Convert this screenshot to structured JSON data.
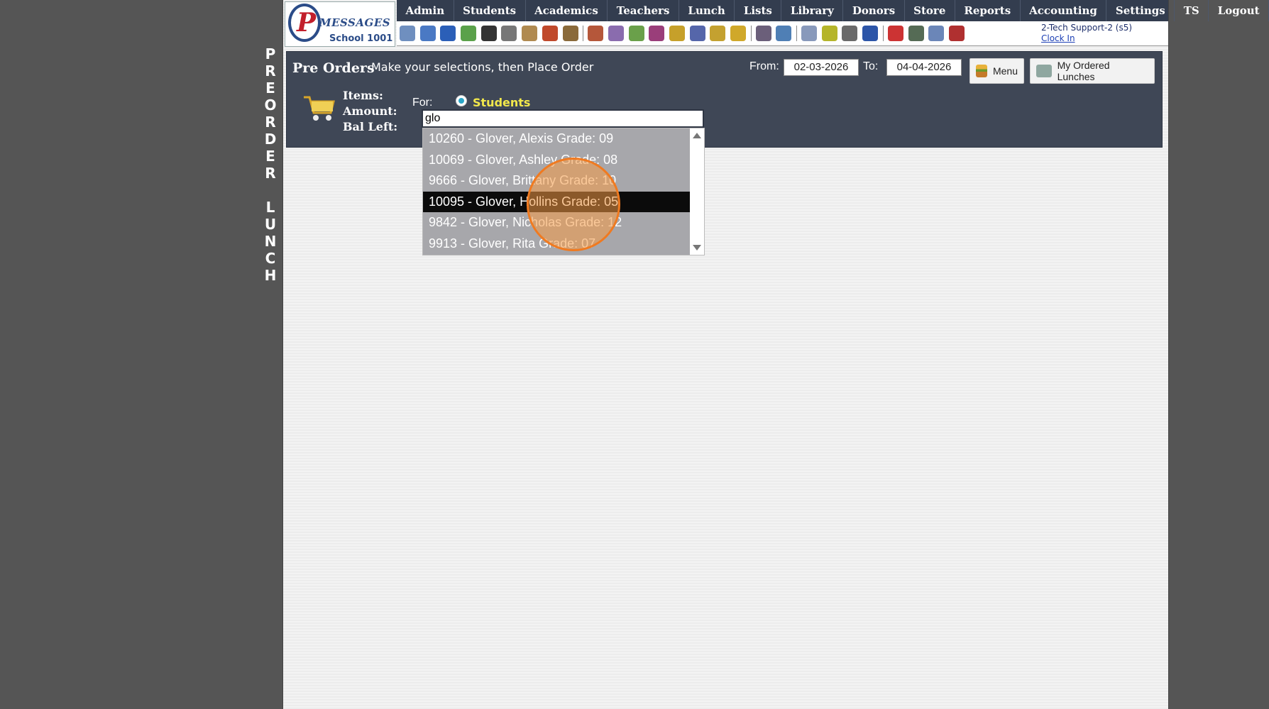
{
  "side_label": [
    "P",
    "R",
    "E",
    "O",
    "R",
    "D",
    "E",
    "R",
    "",
    "L",
    "U",
    "N",
    "C",
    "H"
  ],
  "logo": {
    "word": "MESSAGES",
    "school": "School 1001"
  },
  "nav": [
    "Admin",
    "Students",
    "Academics",
    "Teachers",
    "Lunch",
    "Lists",
    "Library",
    "Donors",
    "Store",
    "Reports",
    "Accounting",
    "Settings",
    "TS",
    "Logout"
  ],
  "toolbar_icons": [
    "search-icon",
    "grid-icon",
    "at-email-icon",
    "chat-icon",
    "phone-icon",
    "speaker-icon",
    "newsletter-icon",
    "calendar-icon",
    "megaphone-icon",
    "separator",
    "student-add-icon",
    "student-icon",
    "tag-icon",
    "group-icon",
    "lunch-icon",
    "book-icon",
    "broom-icon",
    "arrow-icon",
    "separator",
    "teacher-icon",
    "clock-icon",
    "separator",
    "spreadsheet-icon",
    "card-icon",
    "printer-icon",
    "ap-icon",
    "separator",
    "pdf-icon",
    "money-icon",
    "help-icon",
    "power-icon"
  ],
  "user": {
    "name": "2-Tech Support-2 (s5)",
    "clock_in": "Clock In"
  },
  "panel": {
    "title": "Pre Orders",
    "subtitle": "Make your selections, then Place Order",
    "from_label": "From:",
    "from_value": "02-03-2026",
    "to_label": "To:",
    "to_value": "04-04-2026",
    "menu_button": "Menu",
    "ordered_button": "My Ordered Lunches",
    "items_label": "Items:",
    "amount_label": "Amount:",
    "bal_left_label": "Bal Left:",
    "for_label": "For:",
    "radio_label": "Students"
  },
  "search": {
    "value": "glo"
  },
  "dropdown": {
    "options": [
      "10260 - Glover, Alexis Grade: 09",
      "10069 - Glover, Ashley Grade: 08",
      "9666 - Glover, Brittany Grade: 10",
      "10095 - Glover, Hollins Grade: 05",
      "9842 - Glover, Nicholas Grade: 12",
      "9913 - Glover, Rita Grade: 07"
    ],
    "selected_index": 3
  }
}
